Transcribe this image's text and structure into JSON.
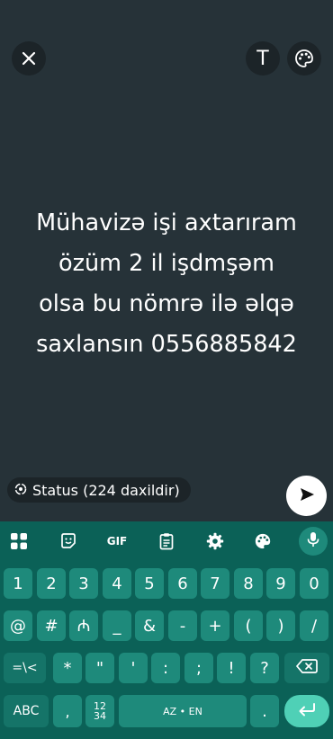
{
  "editor": {
    "close_icon": "close-icon",
    "text_tool_label": "T",
    "palette_icon": "palette-icon",
    "status_text": "Mühavizə işi axtarıram\nözüm 2 il işdmşəm\nolsa bu nömrə ilə əlqə\nsaxlansın 0556885842",
    "audience_label": "Status (224 daxildir)",
    "audience_icon": "status-icon",
    "send_icon": "send-icon",
    "background_color": "#263238"
  },
  "keyboard": {
    "toolbar": {
      "grid_icon": "apps-grid-icon",
      "sticker_icon": "sticker-icon",
      "gif_label": "GIF",
      "clipboard_icon": "clipboard-icon",
      "settings_icon": "gear-icon",
      "theme_icon": "palette-icon",
      "mic_icon": "mic-icon"
    },
    "row1": [
      "1",
      "2",
      "3",
      "4",
      "5",
      "6",
      "7",
      "8",
      "9",
      "0"
    ],
    "row2": [
      "@",
      "#",
      "₼",
      "_",
      "&",
      "-",
      "+",
      "(",
      ")",
      "/"
    ],
    "row3": {
      "shift_label": "=\\<",
      "keys": [
        "*",
        "\"",
        "'",
        ":",
        ";",
        "!",
        "?"
      ],
      "backspace_icon": "backspace-icon"
    },
    "row4": {
      "abc_label": "ABC",
      "comma_label": ",",
      "numpad_top": "12",
      "numpad_bottom": "34",
      "space_label": "AZ • EN",
      "period_label": ".",
      "enter_icon": "enter-icon"
    },
    "colors": {
      "background": "#0b6157",
      "key": "#1e8a7b",
      "accent": "#4fd0b6"
    }
  }
}
